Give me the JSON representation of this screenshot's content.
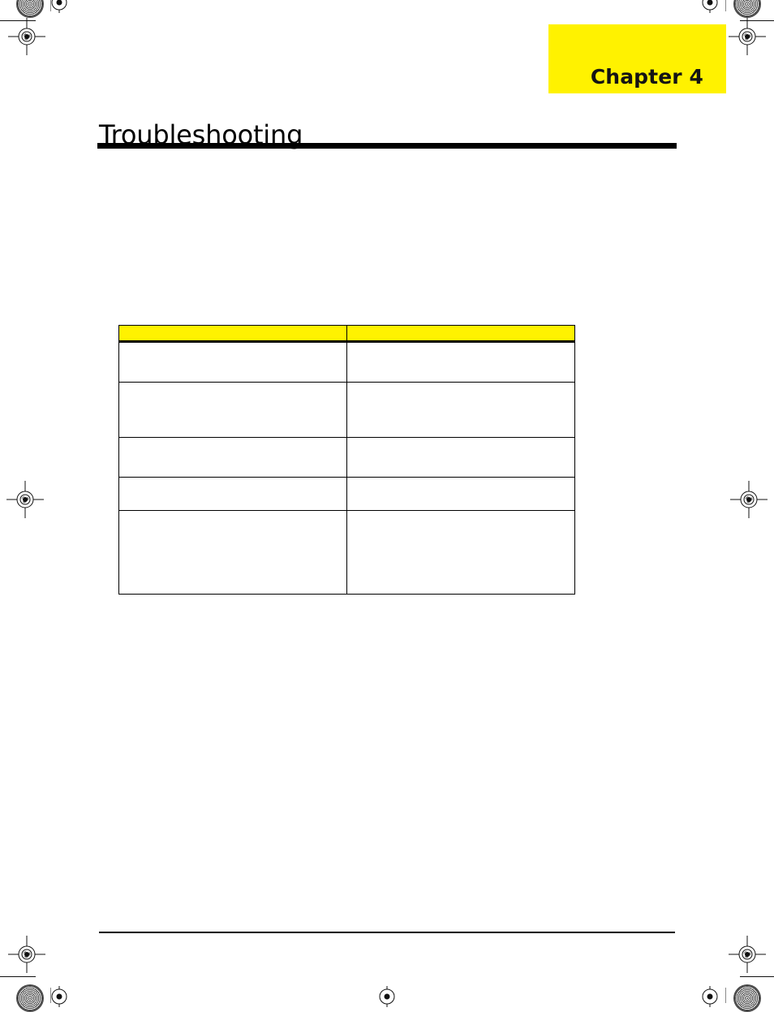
{
  "document": {
    "chapter_tab_label": "Chapter 4",
    "page_title": "Troubleshooting",
    "footer_text": ""
  },
  "colors": {
    "highlight_yellow": "#FFF200",
    "rule_black": "#000000",
    "text_black": "#000000",
    "page_background": "#FFFFFF"
  },
  "table": {
    "headers": [
      "",
      ""
    ],
    "rows": [
      [
        "",
        ""
      ],
      [
        "",
        ""
      ],
      [
        "",
        ""
      ],
      [
        "",
        ""
      ],
      [
        "",
        ""
      ]
    ]
  },
  "print_marks": {
    "registration_icon": "registration-target-icon",
    "calibration_icon": "color-calibration-patch-icon",
    "spoke_icon": "spoke-target-icon"
  }
}
